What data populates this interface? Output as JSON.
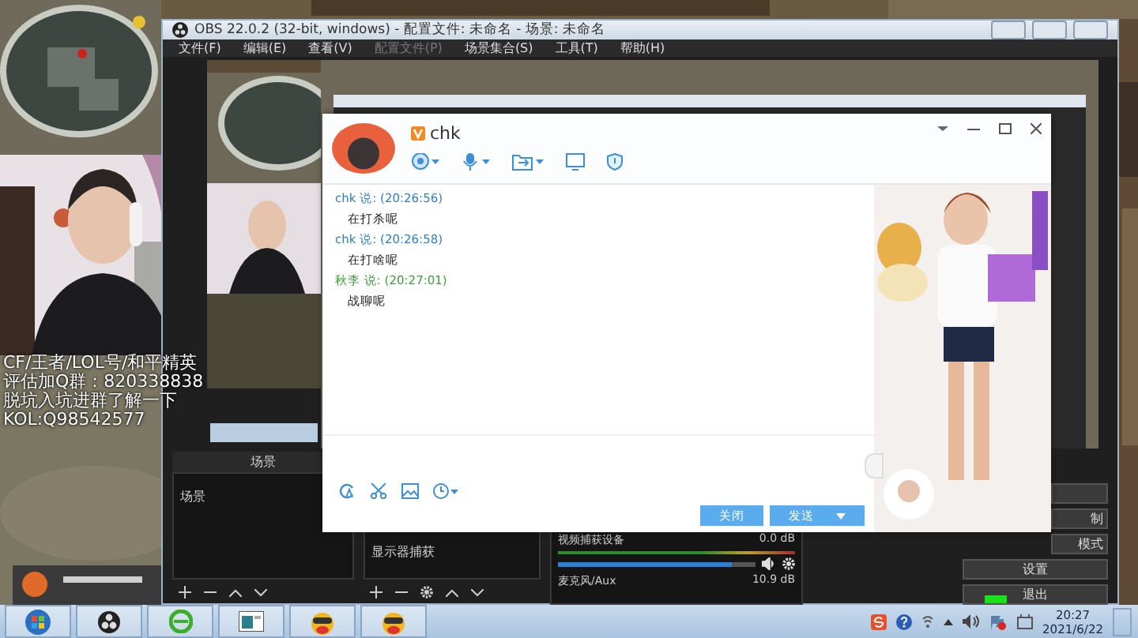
{
  "overlay_text": [
    "CF/王者/LOL号/和平精英",
    "评估加Q群：820338838",
    "脱坑入坑进群了解一下",
    "KOL:Q98542577"
  ],
  "obs": {
    "title": "OBS 22.0.2 (32-bit, windows) - 配置文件: 未命名 - 场景: 未命名",
    "menu": [
      {
        "label": "文件(F)",
        "disabled": false
      },
      {
        "label": "编辑(E)",
        "disabled": false
      },
      {
        "label": "查看(V)",
        "disabled": false
      },
      {
        "label": "配置文件(P)",
        "disabled": true
      },
      {
        "label": "场景集合(S)",
        "disabled": false
      },
      {
        "label": "工具(T)",
        "disabled": false
      },
      {
        "label": "帮助(H)",
        "disabled": false
      }
    ],
    "scenes_title": "场景",
    "scenes": [
      {
        "label": "场景",
        "selected": false
      }
    ],
    "sources": [
      {
        "label": "显示器捕获"
      }
    ],
    "mixer": [
      {
        "name": "视频捕获设备",
        "reading": "0.0 dB",
        "level": 0.88
      },
      {
        "name": "麦克风/Aux",
        "reading": "10.9 dB"
      }
    ],
    "controls": [
      "制",
      "模式",
      "设置",
      "退出"
    ]
  },
  "chat": {
    "contact": "chk",
    "messages": [
      {
        "sender": "chk 说: (20:26:56)",
        "color": "#2f7fc8",
        "text": "在打杀呢"
      },
      {
        "sender": "chk 说: (20:26:58)",
        "color": "#2f7fc8",
        "text": "在打啥呢"
      },
      {
        "sender": "秋李 说: (20:27:01)",
        "color": "#3aa13a",
        "text": "战聊呢"
      }
    ],
    "buttons": [
      {
        "label": "关闭",
        "kind": "plain"
      },
      {
        "label": "发送",
        "kind": "split"
      }
    ]
  },
  "taskbar": {
    "apps": [
      {
        "kind": "start"
      },
      {
        "kind": "obs"
      },
      {
        "kind": "browser"
      },
      {
        "kind": "window"
      },
      {
        "kind": "mascot"
      },
      {
        "kind": "mascot"
      }
    ],
    "time": "20:27",
    "date": "2021/6/22"
  }
}
